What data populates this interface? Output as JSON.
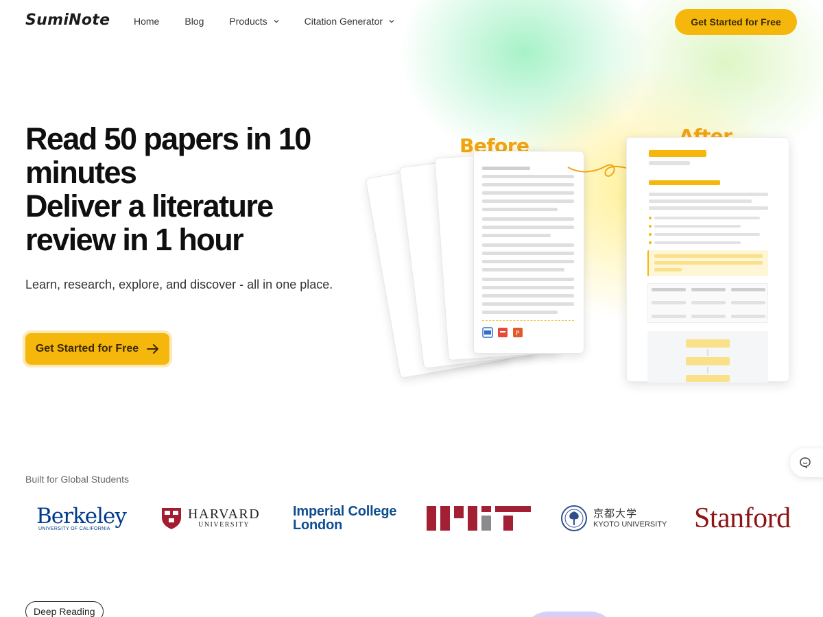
{
  "brand": {
    "name": "SumiNote"
  },
  "nav": {
    "items": [
      {
        "label": "Home",
        "has_dropdown": false
      },
      {
        "label": "Blog",
        "has_dropdown": false
      },
      {
        "label": "Products",
        "has_dropdown": true
      },
      {
        "label": "Citation Generator",
        "has_dropdown": true
      }
    ],
    "cta_label": "Get Started for Free"
  },
  "hero": {
    "title_lines": [
      "Read 50 papers in 10",
      "minutes",
      "Deliver a literature",
      "review in 1 hour"
    ],
    "subtitle": "Learn, research, explore, and discover - all in one place.",
    "cta_label": "Get Started for Free",
    "cta_icon": "arrow-right-icon"
  },
  "illustration": {
    "before_label": "Before",
    "after_label": "After",
    "file_icons": [
      "doc-icon",
      "pdf-icon",
      "ppt-icon"
    ]
  },
  "universities": {
    "label": "Built for Global Students",
    "logos": [
      {
        "name": "Berkeley",
        "subtitle": "UNIVERSITY OF CALIFORNIA"
      },
      {
        "name": "HARVARD",
        "subtitle": "UNIVERSITY"
      },
      {
        "name_line1": "Imperial College",
        "name_line2": "London"
      },
      {
        "name": "MIT"
      },
      {
        "name_jp": "京都大学",
        "name_en": "KYOTO UNIVERSITY"
      },
      {
        "name": "Stanford"
      }
    ]
  },
  "section_tag": "Deep Reading",
  "colors": {
    "accent": "#f5b70c",
    "accent_text": "#3a2a00",
    "label_orange": "#f1a412",
    "berkeley_blue": "#003a8c",
    "imperial_blue": "#0e4d92",
    "mit_red": "#a31f34",
    "stanford_red": "#8c1515"
  }
}
